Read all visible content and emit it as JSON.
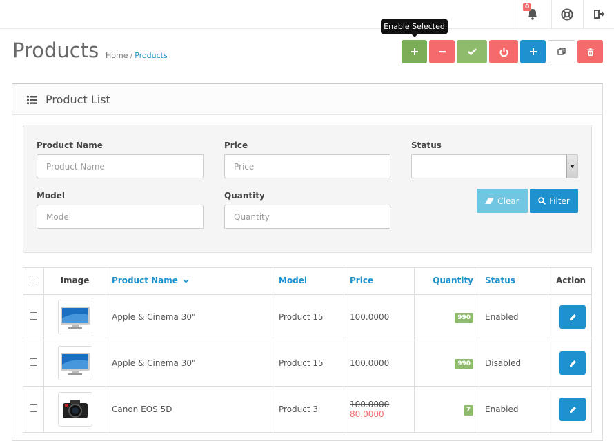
{
  "header": {
    "notification_count": "0",
    "icons": [
      "bell-icon",
      "lifebuoy-icon",
      "sign-out-icon"
    ]
  },
  "page": {
    "title": "Products",
    "breadcrumb": [
      "Home",
      "Products"
    ]
  },
  "toolbar": {
    "tooltip": "Enable Selected",
    "buttons": [
      {
        "icon": "plus-icon",
        "color": "#7cad57"
      },
      {
        "icon": "minus-icon",
        "color": "#f56b6b"
      },
      {
        "icon": "check-icon",
        "color": "#8fbb6c"
      },
      {
        "icon": "power-icon",
        "color": "#f56b6b"
      },
      {
        "icon": "plus-icon",
        "color": "#1e91cf"
      },
      {
        "icon": "copy-icon",
        "color": "#ffffff"
      },
      {
        "icon": "trash-icon",
        "color": "#f56b6b"
      }
    ]
  },
  "panel": {
    "title": "Product List"
  },
  "filter": {
    "product_name_label": "Product Name",
    "product_name_placeholder": "Product Name",
    "price_label": "Price",
    "price_placeholder": "Price",
    "status_label": "Status",
    "status_value": "",
    "model_label": "Model",
    "model_placeholder": "Model",
    "quantity_label": "Quantity",
    "quantity_placeholder": "Quantity",
    "clear_label": "Clear",
    "filter_label": "Filter"
  },
  "table": {
    "headers": {
      "image": "Image",
      "name": "Product Name",
      "model": "Model",
      "price": "Price",
      "quantity": "Quantity",
      "status": "Status",
      "action": "Action"
    },
    "rows": [
      {
        "name": "Apple & Cinema 30\"",
        "model": "Product 15",
        "price": "100.0000",
        "special": "",
        "quantity": "990",
        "status": "Enabled",
        "image": "monitor"
      },
      {
        "name": "Apple & Cinema 30\"",
        "model": "Product 15",
        "price": "100.0000",
        "special": "",
        "quantity": "990",
        "status": "Disabled",
        "image": "monitor"
      },
      {
        "name": "Canon EOS 5D",
        "model": "Product 3",
        "price": "100.0000",
        "special": "80.0000",
        "quantity": "7",
        "status": "Enabled",
        "image": "camera"
      }
    ]
  }
}
